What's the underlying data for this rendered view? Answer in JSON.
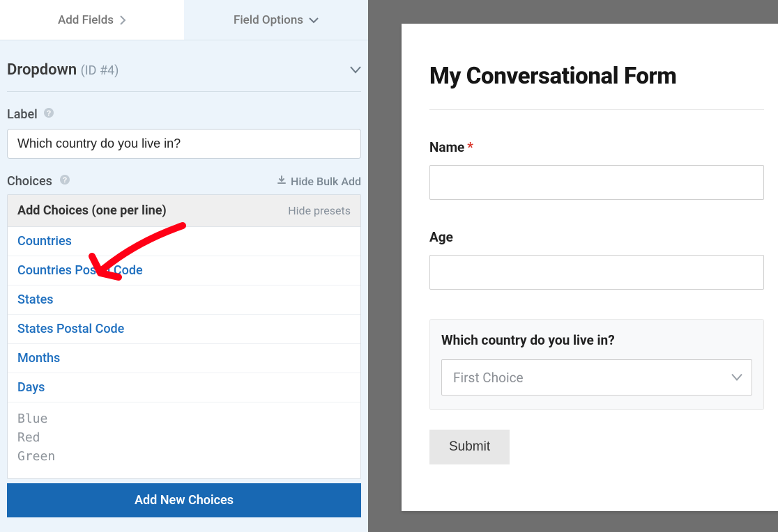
{
  "tabs": {
    "add_fields": "Add Fields",
    "field_options": "Field Options"
  },
  "section": {
    "title": "Dropdown",
    "id_text": "(ID #4)"
  },
  "label": {
    "text": "Label",
    "value": "Which country do you live in?"
  },
  "choices": {
    "header": "Choices",
    "hide_bulk": "Hide Bulk Add",
    "add_title": "Add Choices (one per line)",
    "hide_presets": "Hide presets",
    "presets": [
      "Countries",
      "Countries Postal Code",
      "States",
      "States Postal Code",
      "Months",
      "Days"
    ],
    "text_values": "Blue\nRed\nGreen",
    "add_new": "Add New Choices"
  },
  "preview": {
    "title": "My Conversational Form",
    "fields": {
      "name_label": "Name",
      "name_required": "*",
      "age_label": "Age",
      "country_label": "Which country do you live in?",
      "country_placeholder": "First Choice",
      "submit_label": "Submit"
    }
  }
}
